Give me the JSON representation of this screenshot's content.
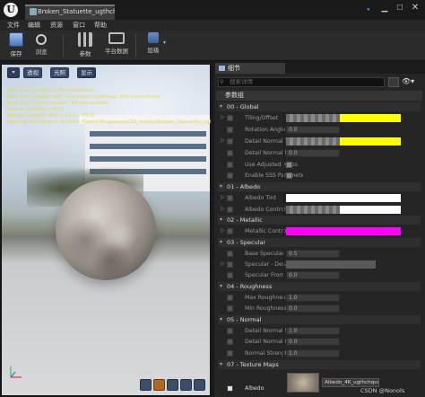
{
  "window": {
    "tab_title": "Broken_Statuette_ugthch",
    "min_glyph": "▁",
    "max_glyph": "☐",
    "close_glyph": "✕",
    "pin_glyph": "🔹"
  },
  "menu": [
    "文件",
    "编辑",
    "资源",
    "窗口",
    "帮助"
  ],
  "toolbar": {
    "save": "保存",
    "browse": "浏览",
    "params": "参数",
    "platform": "平台数据",
    "hierarchy": "层级"
  },
  "viewport": {
    "btn_perspective": "透视",
    "btn_lit": "光照",
    "btn_show": "显示",
    "stats": [
      "Base pass shader: 174 instructions",
      "Base pass shader with Volumetric Lightmap: 245 instructions",
      "Base pass vertex shader: 69 instructions",
      "Texture samplers: 4/16",
      "Texture Lookups (Est.): VS(0), PS(3)",
      "Warning: Roughness samples /Game/Megascans/3D_Assets/Broken_Statuette_ugthchqva..."
    ]
  },
  "details": {
    "tab": "细节",
    "search_placeholder": "搜索详情",
    "params_header": "参数组",
    "categories": [
      {
        "label": "00 - Global"
      },
      {
        "label": "01 - Albedo"
      },
      {
        "label": "02 - Metallic"
      },
      {
        "label": "03 - Specular"
      },
      {
        "label": "04 - Roughness"
      },
      {
        "label": "05 - Normal"
      },
      {
        "label": "07 - Texture Maps"
      }
    ],
    "rows": {
      "tiling_offset": "Tiling/Offset",
      "rotation_angle": "Rotation Angle",
      "rotation_angle_val": "0.0",
      "detail_normal_tiling": "Detail Normal Tiling/",
      "detail_normal_rotation": "Detail Normal Rotatio",
      "detail_normal_rotation_val": "0.0",
      "use_adjusted_maps": "Use Adjusted Maps",
      "enable_sss": "Enable SSS Paramete",
      "albedo_tint": "Albedo Tint",
      "albedo_controls": "Albedo Controls",
      "metallic_controls": "Metallic Controls",
      "base_specular": "Base Specular",
      "base_specular_val": "0.5",
      "specular_desaturate": "Specular - Desaturat",
      "specular_from_albedo": "Specular From Albed",
      "specular_from_albedo_val": "0.0",
      "max_roughness": "Max Roughness",
      "max_roughness_val": "1.0",
      "min_roughness": "Min Roughness",
      "min_roughness_val": "0.0",
      "detail_normal_strength": "Detail Normal Streng",
      "detail_normal_strength_val": "1.0",
      "detail_normal_override": "Detail Normal Overri",
      "detail_normal_override_val": "0.0",
      "normal_strength": "Normal Strength",
      "normal_strength_val": "1.0",
      "albedo": "Albedo",
      "albedo_texture": "Albedo_4K_ugthchqva ▾"
    }
  },
  "colors": {
    "yellow": "#ffff00",
    "white": "#ffffff",
    "magenta": "#ff00ff"
  },
  "watermark": "CSDN @Nonols"
}
